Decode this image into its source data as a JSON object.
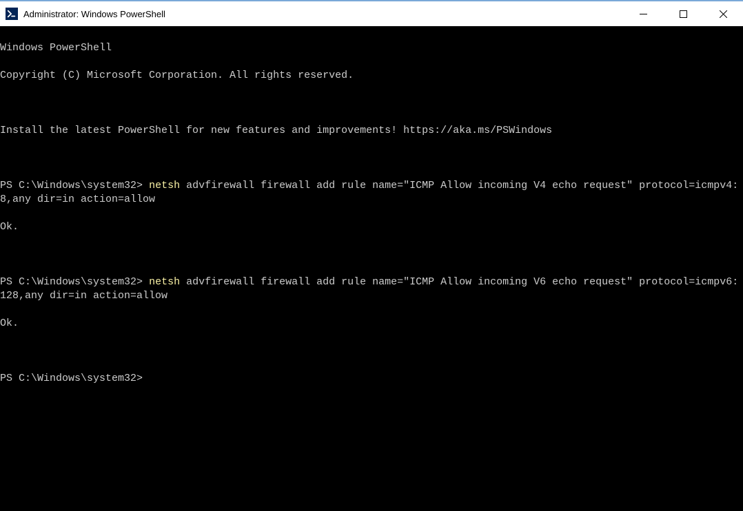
{
  "window": {
    "title": "Administrator: Windows PowerShell"
  },
  "terminal": {
    "header_line1": "Windows PowerShell",
    "header_line2": "Copyright (C) Microsoft Corporation. All rights reserved.",
    "install_msg": "Install the latest PowerShell for new features and improvements! https://aka.ms/PSWindows",
    "prompt": "PS C:\\Windows\\system32>",
    "cmd_name": "netsh",
    "cmd1_args": " advfirewall firewall add rule name=\"ICMP Allow incoming V4 echo request\" protocol=icmpv4:8,any dir=in action=allow",
    "result1": "Ok.",
    "cmd2_args": " advfirewall firewall add rule name=\"ICMP Allow incoming V6 echo request\" protocol=icmpv6:128,any dir=in action=allow",
    "result2": "Ok."
  }
}
